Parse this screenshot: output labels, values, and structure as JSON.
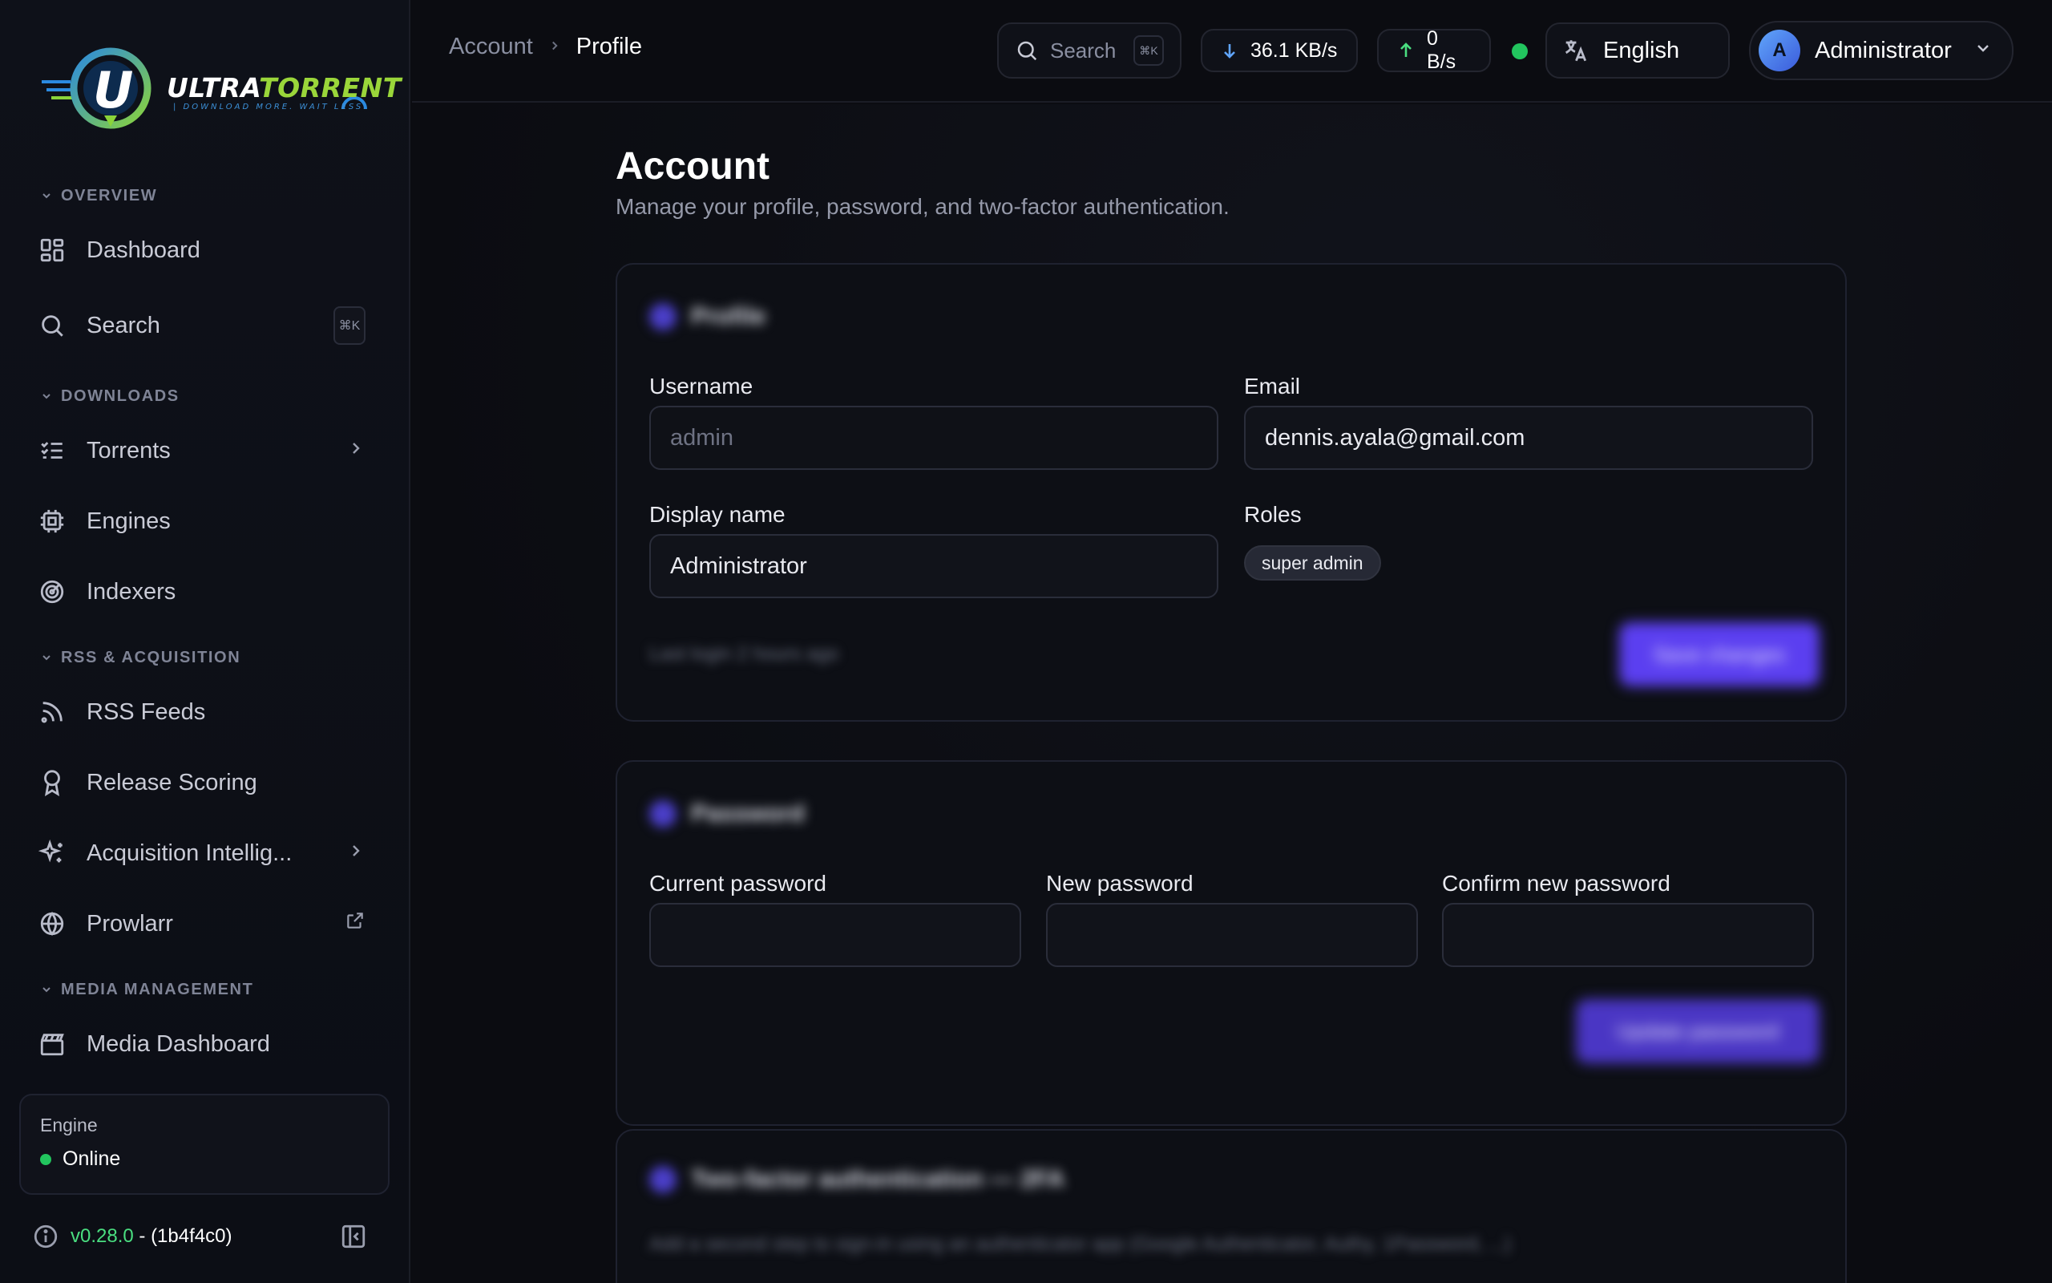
{
  "brand": {
    "wordmark_main": "ULTRA",
    "wordmark_accent": "TORRENT",
    "tagline": "| DOWNLOAD MORE. WAIT LESS."
  },
  "sidebar": {
    "sections": [
      {
        "label": "OVERVIEW"
      },
      {
        "label": "DOWNLOADS"
      },
      {
        "label": "RSS & ACQUISITION"
      },
      {
        "label": "MEDIA MANAGEMENT"
      }
    ],
    "items": [
      {
        "label": "Dashboard",
        "icon": "dashboard-icon"
      },
      {
        "label": "Search",
        "icon": "search-icon",
        "shortcut": "⌘K"
      },
      {
        "label": "Torrents",
        "icon": "list-check-icon"
      },
      {
        "label": "Engines",
        "icon": "cpu-icon"
      },
      {
        "label": "Indexers",
        "icon": "radar-icon"
      },
      {
        "label": "RSS Feeds",
        "icon": "rss-icon"
      },
      {
        "label": "Release Scoring",
        "icon": "award-icon"
      },
      {
        "label": "Acquisition Intellig...",
        "icon": "sparkles-icon"
      },
      {
        "label": "Prowlarr",
        "icon": "globe-icon"
      },
      {
        "label": "Media Dashboard",
        "icon": "clapperboard-icon"
      }
    ],
    "engine": {
      "label": "Engine",
      "status": "Online",
      "status_color": "#22c55e"
    },
    "version": {
      "number": "v0.28.0",
      "separator": " - ",
      "build": "(1b4f4c0)"
    }
  },
  "topbar": {
    "breadcrumb": {
      "parent": "Account",
      "current": "Profile"
    },
    "search": {
      "label": "Search",
      "shortcut": "⌘K"
    },
    "download_speed": "36.1 KB/s",
    "upload_speed": "0 B/s",
    "language": "English",
    "user": {
      "name": "Administrator",
      "initial": "A"
    }
  },
  "page": {
    "title": "Account",
    "subtitle": "Manage your profile, password, and two-factor authentication."
  },
  "profile": {
    "heading": "Profile",
    "username_label": "Username",
    "username_value": "admin",
    "email_label": "Email",
    "email_value": "dennis.ayala@gmail.com",
    "display_name_label": "Display name",
    "display_name_value": "Administrator",
    "roles_label": "Roles",
    "roles": [
      "super admin"
    ],
    "footer_note": "Last login 2 hours ago",
    "save_label": "Save changes"
  },
  "password": {
    "heading": "Password",
    "current_label": "Current password",
    "new_label": "New password",
    "confirm_label": "Confirm new password",
    "update_label": "Update password"
  },
  "twofa": {
    "heading": "Two-factor authentication — 2FA",
    "description": "Add a second step to sign-in using an authenticator app (Google Authenticator, Authy, 1Password, ...)"
  },
  "colors": {
    "accent": "#5b3ff0",
    "online": "#22c55e",
    "version": "#4ade80",
    "download_arrow": "#60a5fa",
    "upload_arrow": "#4ade80"
  }
}
